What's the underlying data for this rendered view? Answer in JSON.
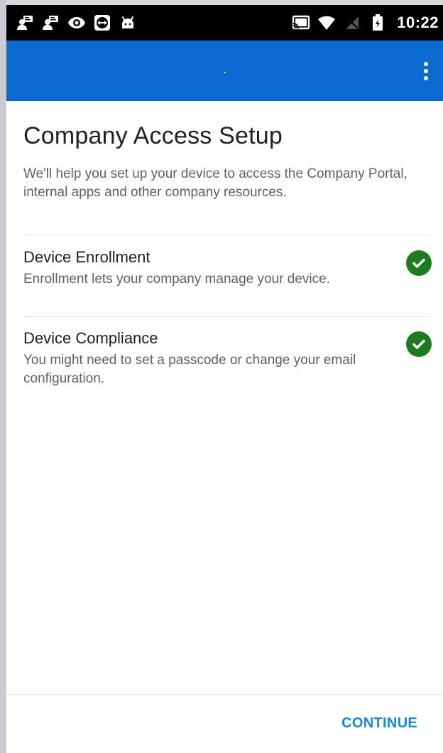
{
  "status_bar": {
    "time": "10:22",
    "left_icons": [
      "user-card-icon",
      "user-card-icon",
      "eye-icon",
      "teamviewer-icon",
      "android-icon"
    ],
    "right_icons": [
      "cast-icon",
      "wifi-icon",
      "no-signal-icon",
      "battery-icon"
    ]
  },
  "app_bar": {
    "title": ".",
    "background": "#0b6bd3"
  },
  "page": {
    "title": "Company Access Setup",
    "description": "We'll help you set up your device to access the Company Portal, internal apps and other company resources."
  },
  "steps": [
    {
      "title": "Device Enrollment",
      "description": "Enrollment lets your company manage your device.",
      "status_icon": "check-circle-icon",
      "status_color": "#1e7b1e"
    },
    {
      "title": "Device Compliance",
      "description": "You might need to set a passcode or change your email configuration.",
      "status_icon": "check-circle-icon",
      "status_color": "#1e7b1e"
    }
  ],
  "footer": {
    "continue_label": "CONTINUE",
    "accent": "#1a86d8"
  }
}
